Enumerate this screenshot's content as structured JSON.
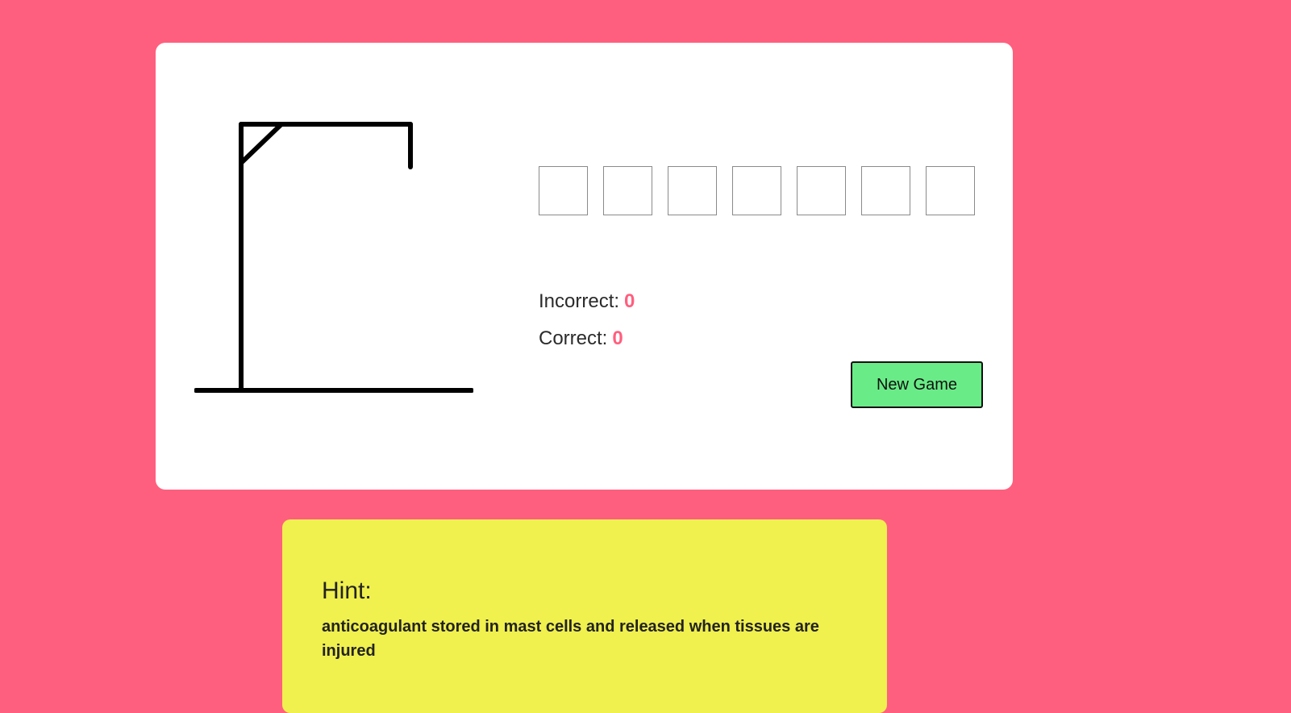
{
  "game": {
    "word_slots": [
      "",
      "",
      "",
      "",
      "",
      "",
      ""
    ],
    "incorrect_label": "Incorrect:",
    "incorrect_count": "0",
    "correct_label": "Correct:",
    "correct_count": "0",
    "new_game_label": "New Game"
  },
  "hint": {
    "title": "Hint:",
    "text": "anticoagulant stored in mast cells and released when tissues are injured"
  },
  "colors": {
    "background": "#ff5f7e",
    "card": "#ffffff",
    "hint_card": "#f0f04e",
    "button": "#69ec87",
    "count": "#ff5f7e"
  }
}
